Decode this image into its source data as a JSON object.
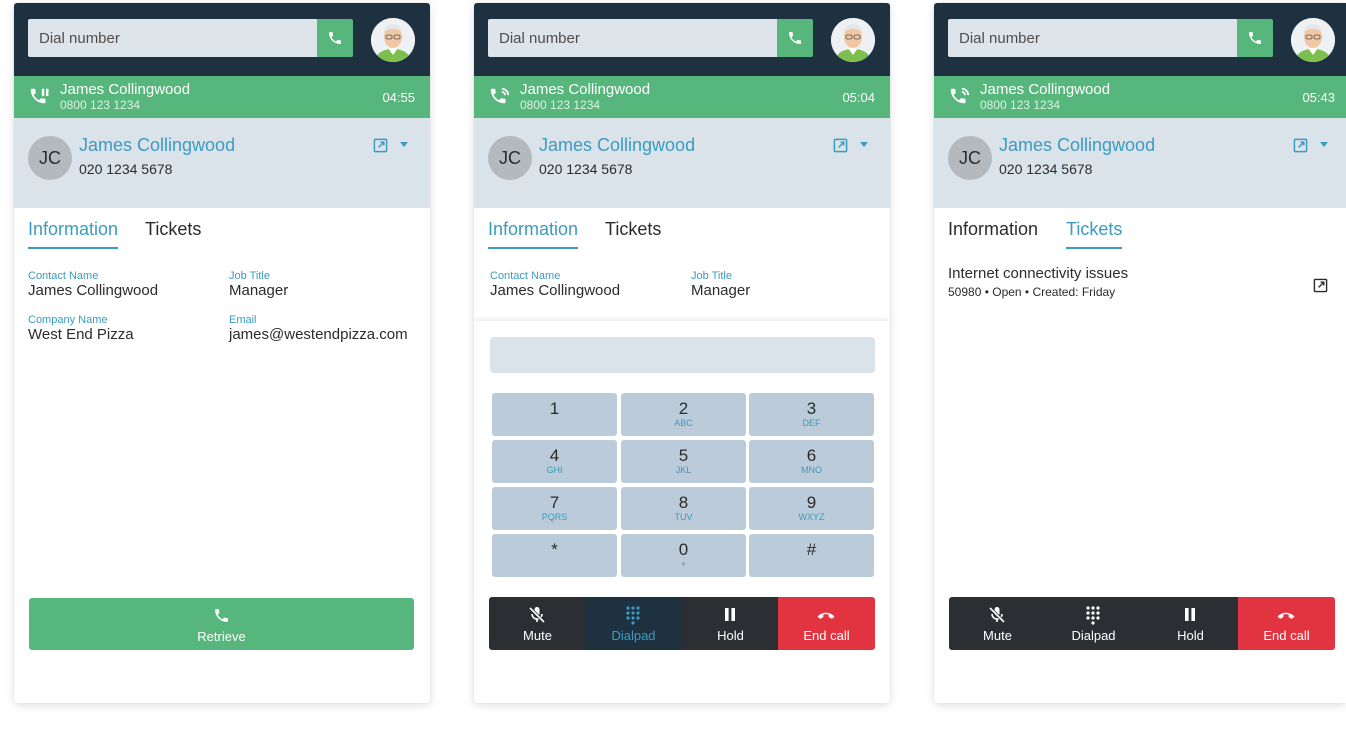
{
  "colors": {
    "topbar": "#1d3140",
    "call_green": "#57b67c",
    "accent": "#3b9bc0",
    "end_red": "#e23440",
    "contact_bg": "#dbe3ea",
    "key_bg": "#bccbd9"
  },
  "panels": [
    {
      "dial_placeholder": "Dial number",
      "call": {
        "name": "James Collingwood",
        "number": "0800 123 1234",
        "timer": "04:55",
        "icon": "call-hold-icon"
      },
      "contact": {
        "initials": "JC",
        "name": "James Collingwood",
        "number": "020 1234 5678"
      },
      "tabs": [
        "Information",
        "Tickets"
      ],
      "active_tab": "Information",
      "info": {
        "contact_name_label": "Contact Name",
        "contact_name": "James Collingwood",
        "job_title_label": "Job Title",
        "job_title": "Manager",
        "company_name_label": "Company Name",
        "company_name": "West End Pizza",
        "email_label": "Email",
        "email": "james@westendpizza.com"
      },
      "retrieve_label": "Retrieve"
    },
    {
      "dial_placeholder": "Dial number",
      "call": {
        "name": "James Collingwood",
        "number": "0800 123 1234",
        "timer": "05:04",
        "icon": "call-active-icon"
      },
      "contact": {
        "initials": "JC",
        "name": "James Collingwood",
        "number": "020 1234 5678"
      },
      "tabs": [
        "Information",
        "Tickets"
      ],
      "active_tab": "Information",
      "info": {
        "contact_name_label": "Contact Name",
        "contact_name": "James Collingwood",
        "job_title_label": "Job Title",
        "job_title": "Manager"
      },
      "dialpad": {
        "keys": [
          {
            "digit": "1",
            "letters": ""
          },
          {
            "digit": "2",
            "letters": "ABC"
          },
          {
            "digit": "3",
            "letters": "DEF"
          },
          {
            "digit": "4",
            "letters": "GHI"
          },
          {
            "digit": "5",
            "letters": "JKL"
          },
          {
            "digit": "6",
            "letters": "MNO"
          },
          {
            "digit": "7",
            "letters": "PQRS"
          },
          {
            "digit": "8",
            "letters": "TUV"
          },
          {
            "digit": "9",
            "letters": "WXYZ"
          },
          {
            "digit": "*",
            "letters": ""
          },
          {
            "digit": "0",
            "letters": "+"
          },
          {
            "digit": "#",
            "letters": ""
          }
        ]
      },
      "controls": {
        "mute": "Mute",
        "dialpad": "Dialpad",
        "hold": "Hold",
        "end": "End call",
        "active": "Dialpad"
      }
    },
    {
      "dial_placeholder": "Dial number",
      "call": {
        "name": "James Collingwood",
        "number": "0800 123 1234",
        "timer": "05:43",
        "icon": "call-active-icon"
      },
      "contact": {
        "initials": "JC",
        "name": "James Collingwood",
        "number": "020 1234 5678"
      },
      "tabs": [
        "Information",
        "Tickets"
      ],
      "active_tab": "Tickets",
      "ticket": {
        "title": "Internet connectivity issues",
        "meta": "50980  •  Open  •  Created: Friday"
      },
      "controls": {
        "mute": "Mute",
        "dialpad": "Dialpad",
        "hold": "Hold",
        "end": "End call"
      }
    }
  ]
}
